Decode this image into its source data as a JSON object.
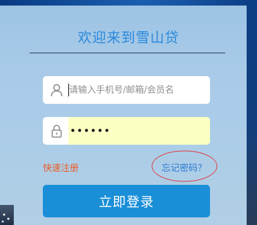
{
  "title": "欢迎来到雪山贷",
  "username": {
    "placeholder": "请输入手机号/邮箱/会员名",
    "value": "",
    "icon": "user-icon"
  },
  "password": {
    "value": "••••••",
    "icon": "lock-icon"
  },
  "links": {
    "register": "快速注册",
    "forgot": "忘记密码？"
  },
  "login_button": "立即登录",
  "colors": {
    "title": "#2a89dc",
    "register_link": "#ec5a23",
    "forgot_link": "#2a7ad1",
    "button": "#1a8fd8",
    "annotation_ellipse": "#e0383e",
    "autofill": "#fbffc2"
  }
}
